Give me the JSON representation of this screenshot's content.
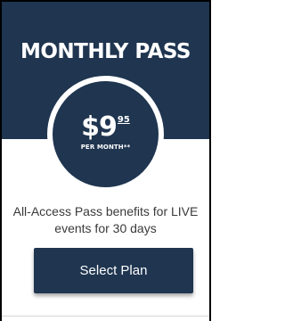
{
  "plan": {
    "title": "MONTHLY PASS",
    "price_amount": "$9",
    "price_cents": "95",
    "price_period": "PER MONTH**",
    "description": "All-Access Pass benefits for LIVE events for 30 days",
    "cta_label": "Select Plan"
  },
  "colors": {
    "header_bg": "#1f3550",
    "button_bg": "#1f3550",
    "text_dark": "#3a3a3a",
    "text_light": "#ffffff"
  }
}
